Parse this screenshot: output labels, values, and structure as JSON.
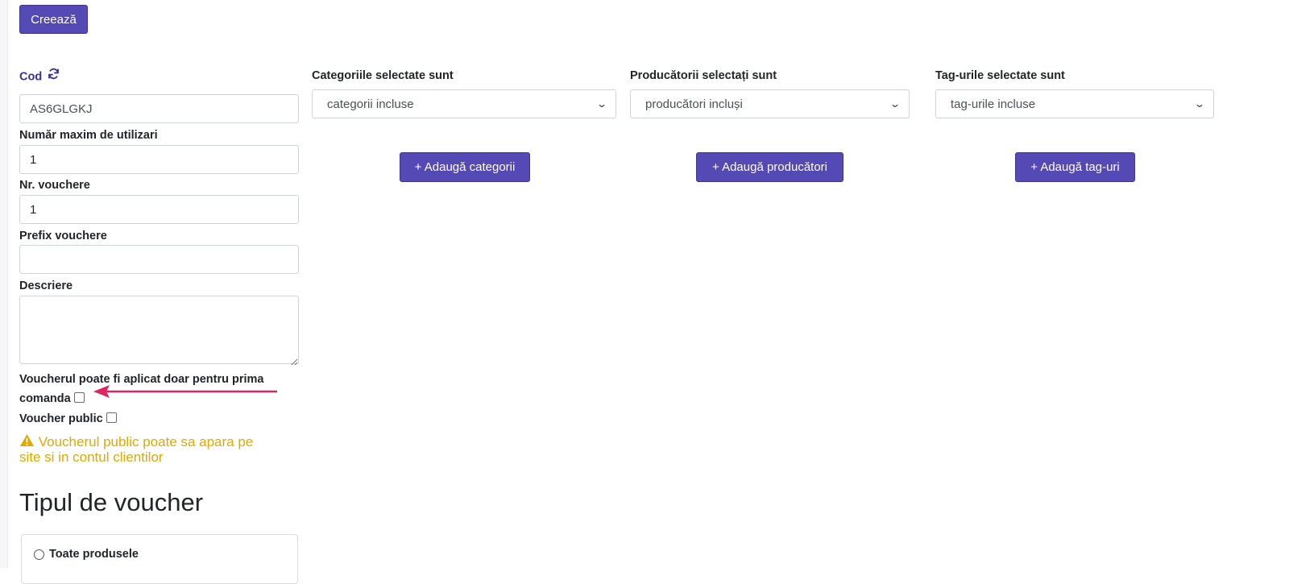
{
  "header": {
    "create_label": "Creează"
  },
  "form": {
    "code_label": "Cod",
    "code_value": "AS6GLGKJ",
    "max_users_label": "Număr maxim de utilizari",
    "max_users_value": "1",
    "vouchers_count_label": "Nr. vouchere",
    "vouchers_count_value": "1",
    "prefix_label": "Prefix vouchere",
    "prefix_value": "",
    "description_label": "Descriere",
    "description_value": "",
    "first_order_label_line1": "Voucherul poate fi aplicat doar pentru prima",
    "first_order_label_line2": "comanda",
    "public_label": "Voucher public",
    "public_warning_line1": "Voucherul public poate sa apara pe",
    "public_warning_line2": "site si in contul clientilor"
  },
  "filters": {
    "categories": {
      "label": "Categoriile selectate sunt",
      "selected": "categorii incluse",
      "add_button": "+ Adaugă categorii"
    },
    "producers": {
      "label": "Producătorii selectați sunt",
      "selected": "producători incluși",
      "add_button": "+ Adaugă producători"
    },
    "tags": {
      "label": "Tag-urile selectate sunt",
      "selected": "tag-urile incluse",
      "add_button": "+ Adaugă tag-uri"
    }
  },
  "voucher_type": {
    "title": "Tipul de voucher",
    "option_all": "Toate produsele"
  },
  "colors": {
    "accent": "#5549b5",
    "warning": "#e0a800",
    "arrow": "#e0245e"
  }
}
